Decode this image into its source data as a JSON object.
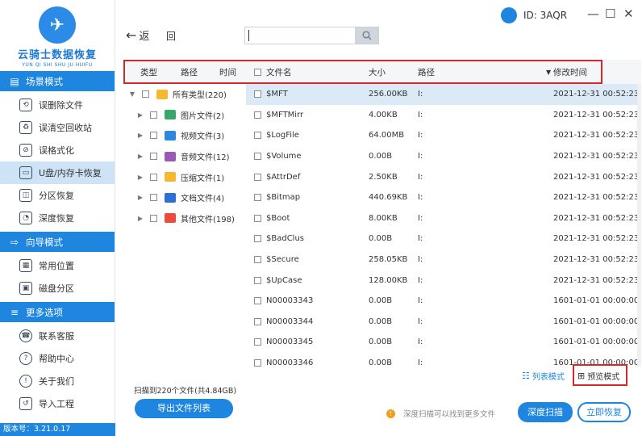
{
  "app": {
    "logo_title": "云骑士数据恢复",
    "logo_sub": "YUN QI SHI SHU JU HUIFU",
    "version": "版本号：3.21.0.17",
    "id_label": "ID: 3AQR"
  },
  "sidebar": {
    "sections": [
      {
        "title": "场景模式",
        "items": [
          "误删除文件",
          "误清空回收站",
          "误格式化",
          "U盘/内存卡恢复",
          "分区恢复",
          "深度恢复"
        ]
      },
      {
        "title": "向导模式",
        "items": [
          "常用位置",
          "磁盘分区"
        ]
      },
      {
        "title": "更多选项",
        "items": [
          "联系客服",
          "帮助中心",
          "关于我们",
          "导入工程"
        ]
      }
    ],
    "active_item": "U盘/内存卡恢复"
  },
  "toolbar": {
    "back_label": "返",
    "back2_label": "回",
    "search_placeholder": ""
  },
  "left_header": {
    "type": "类型",
    "path": "路径",
    "time": "时间"
  },
  "columns": {
    "name": "文件名",
    "size": "大小",
    "path": "路径",
    "modified": "修改时间"
  },
  "tree": [
    {
      "label": "所有类型(220)",
      "expanded": true,
      "color": "#f5b82e"
    },
    {
      "label": "图片文件(2)",
      "color": "#3aa66a"
    },
    {
      "label": "视频文件(3)",
      "color": "#2e86de"
    },
    {
      "label": "音频文件(12)",
      "color": "#9b59b6"
    },
    {
      "label": "压缩文件(1)",
      "color": "#f5b82e"
    },
    {
      "label": "文档文件(4)",
      "color": "#2e6fd6"
    },
    {
      "label": "其他文件(198)",
      "color": "#e74c3c"
    }
  ],
  "files": [
    {
      "name": "$MFT",
      "size": "256.00KB",
      "path": "I:",
      "time": "2021-12-31 00:52:23"
    },
    {
      "name": "$MFTMirr",
      "size": "4.00KB",
      "path": "I:",
      "time": "2021-12-31 00:52:23"
    },
    {
      "name": "$LogFile",
      "size": "64.00MB",
      "path": "I:",
      "time": "2021-12-31 00:52:23"
    },
    {
      "name": "$Volume",
      "size": "0.00B",
      "path": "I:",
      "time": "2021-12-31 00:52:23"
    },
    {
      "name": "$AttrDef",
      "size": "2.50KB",
      "path": "I:",
      "time": "2021-12-31 00:52:23"
    },
    {
      "name": "$Bitmap",
      "size": "440.69KB",
      "path": "I:",
      "time": "2021-12-31 00:52:23"
    },
    {
      "name": "$Boot",
      "size": "8.00KB",
      "path": "I:",
      "time": "2021-12-31 00:52:23"
    },
    {
      "name": "$BadClus",
      "size": "0.00B",
      "path": "I:",
      "time": "2021-12-31 00:52:23"
    },
    {
      "name": "$Secure",
      "size": "258.05KB",
      "path": "I:",
      "time": "2021-12-31 00:52:23"
    },
    {
      "name": "$UpCase",
      "size": "128.00KB",
      "path": "I:",
      "time": "2021-12-31 00:52:23"
    },
    {
      "name": "N00003343",
      "size": "0.00B",
      "path": "I:",
      "time": "1601-01-01 00:00:00"
    },
    {
      "name": "N00003344",
      "size": "0.00B",
      "path": "I:",
      "time": "1601-01-01 00:00:00"
    },
    {
      "name": "N00003345",
      "size": "0.00B",
      "path": "I:",
      "time": "1601-01-01 00:00:00"
    },
    {
      "name": "N00003346",
      "size": "0.00B",
      "path": "I:",
      "time": "1601-01-01 00:00:00"
    }
  ],
  "view": {
    "list_mode": "列表模式",
    "preview_mode": "预览模式"
  },
  "footer": {
    "scan_info": "扫描到220个文件(共4.84GB)",
    "export_label": "导出文件列表",
    "tip": "深度扫描可以找到更多文件",
    "deep_scan": "深度扫描",
    "recover": "立即恢复"
  },
  "colors": {
    "accent": "#1f86e0",
    "highlight": "#d9262c"
  }
}
